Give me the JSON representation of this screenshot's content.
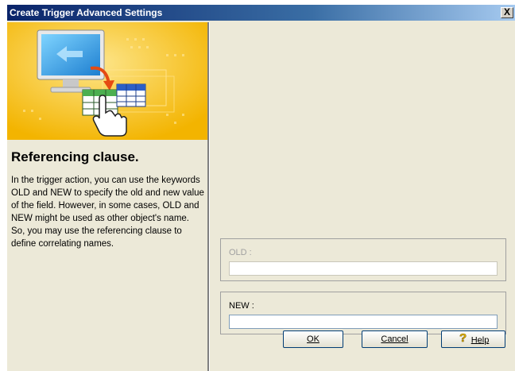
{
  "window": {
    "title": "Create Trigger Advanced Settings",
    "close_glyph": "X"
  },
  "left": {
    "heading": "Referencing clause.",
    "description": "In the trigger action, you can use the keywords OLD and NEW to specify the old and new value of the field. However, in some cases, OLD and NEW might be used as other object's name. So, you may use the referencing clause to define correlating names."
  },
  "right": {
    "old": {
      "label": "OLD :",
      "value": "",
      "enabled": false
    },
    "new": {
      "label": "NEW :",
      "value": "",
      "enabled": true
    }
  },
  "buttons": {
    "ok": "OK",
    "cancel": "Cancel",
    "help": "Help"
  },
  "icons": [
    "computer-monitor-icon",
    "arrow-icon",
    "table-icon",
    "hand-pointer-icon",
    "help-icon",
    "close-icon"
  ]
}
